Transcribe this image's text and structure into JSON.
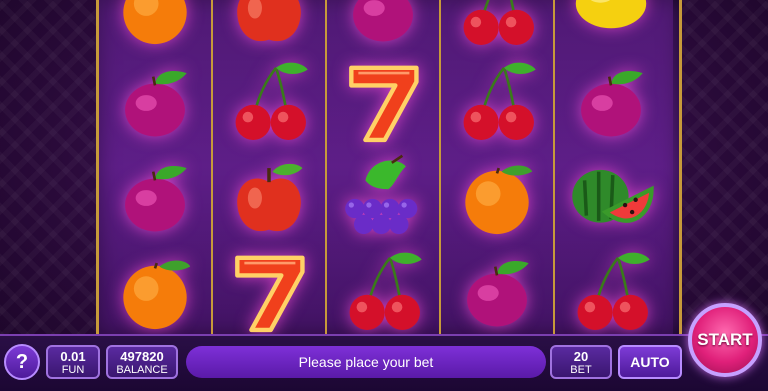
{
  "game": {
    "reels": [
      [
        "orange",
        "plum",
        "plum",
        "orange"
      ],
      [
        "apple",
        "cherry",
        "apple",
        "seven"
      ],
      [
        "plum",
        "seven",
        "grapes",
        "cherry"
      ],
      [
        "cherry",
        "cherry",
        "orange",
        "plum"
      ],
      [
        "lemon",
        "plum",
        "watermelon",
        "cherry"
      ]
    ]
  },
  "controls": {
    "help_label": "?",
    "fun_value": "0.01",
    "fun_label": "FUN",
    "balance_value": "497820",
    "balance_label": "BALANCE",
    "message": "Please place your bet",
    "bet_value": "20",
    "bet_label": "BET",
    "auto_label": "AUTO",
    "start_label": "START"
  },
  "colors": {
    "accent": "#e0207a",
    "panel": "#5a1aa8",
    "frame_gold": "#c79a3a"
  },
  "icons": {
    "orange": "orange-icon",
    "plum": "plum-icon",
    "apple": "apple-icon",
    "cherry": "cherry-icon",
    "seven": "seven-icon",
    "grapes": "grapes-icon",
    "lemon": "lemon-icon",
    "watermelon": "watermelon-icon"
  }
}
